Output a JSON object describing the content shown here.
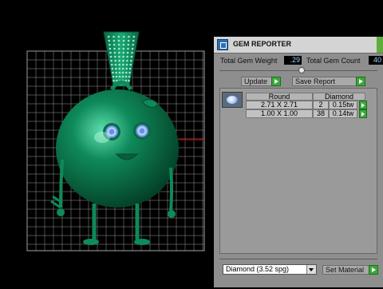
{
  "panel": {
    "title": "GEM REPORTER",
    "total_weight_label": "Total Gem Weight",
    "total_weight_value": ".29",
    "total_count_label": "Total Gem Count",
    "total_count_value": "40",
    "update_label": "Update",
    "save_report_label": "Save Report",
    "table": {
      "headers": [
        "Round",
        "Diamond"
      ],
      "rows": [
        {
          "size": "2.71 X 2.71",
          "count": "2",
          "weight": "0.15tw"
        },
        {
          "size": "1.00 X 1.00",
          "count": "38",
          "weight": "0.14tw"
        }
      ]
    },
    "material_select_value": "Diamond     (3.52 spg)",
    "set_material_label": "Set Material"
  },
  "colors": {
    "model": "#0f8a5a",
    "eyes": "#a8d4ff",
    "grid": "#c8c8c8",
    "button_arrow": "#3aa83a",
    "axis_red": "#b00000"
  },
  "icons": [
    "gem-reporter-icon",
    "gem-thumbnail-icon",
    "arrow-right-icon",
    "dropdown-arrow-icon"
  ]
}
